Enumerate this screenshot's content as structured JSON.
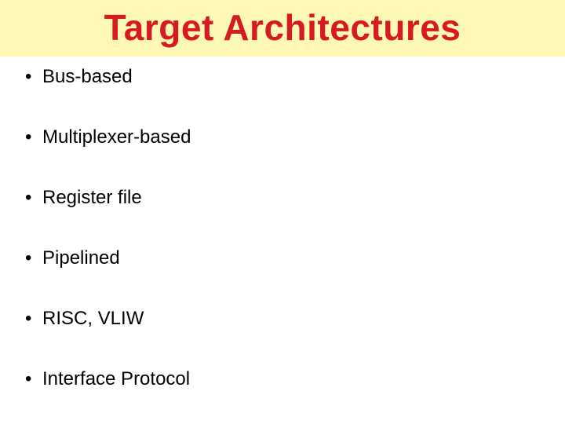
{
  "title": "Target Architectures",
  "bullets": [
    "Bus-based",
    "Multiplexer-based",
    "Register file",
    "Pipelined",
    "RISC, VLIW",
    "Interface Protocol"
  ]
}
